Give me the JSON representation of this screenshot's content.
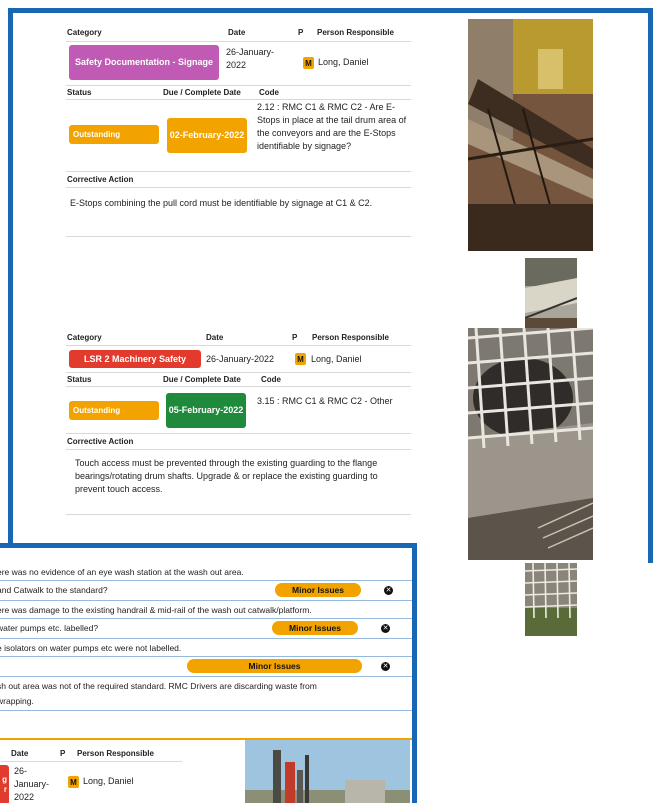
{
  "colors": {
    "frame_blue": "#1767b3",
    "status_orange": "#f2a300",
    "due_green": "#1f8a3b",
    "category_purple": "#c05ab5",
    "category_red": "#e23b2e"
  },
  "card1": {
    "hdr_category": "Category",
    "hdr_date": "Date",
    "hdr_p": "P",
    "hdr_person": "Person Responsible",
    "category": "Safety Documentation - Signage",
    "date": "26-January-2022",
    "priority": "M",
    "person": "Long, Daniel",
    "hdr_status": "Status",
    "hdr_due": "Due / Complete Date",
    "hdr_code": "Code",
    "status": "Outstanding",
    "due": "02-February-2022",
    "code": "2.12 : RMC C1 & RMC C2 - Are E-Stops in place at the tail drum area of the conveyors and are the E-Stops identifiable by signage?",
    "hdr_action": "Corrective Action",
    "action": "E-Stops combining the pull cord must be identifiable by signage at C1 & C2."
  },
  "card2": {
    "hdr_category": "Category",
    "hdr_date": "Date",
    "hdr_p": "P",
    "hdr_person": "Person Responsible",
    "category": "LSR 2 Machinery Safety",
    "date": "26-January-2022",
    "priority": "M",
    "person": "Long, Daniel",
    "hdr_status": "Status",
    "hdr_due": "Due / Complete Date",
    "hdr_code": "Code",
    "status": "Outstanding",
    "due": "05-February-2022",
    "code": "3.15 : RMC C1 & RMC C2 - Other",
    "hdr_action": "Corrective Action",
    "action": "Touch access must be prevented through the existing guarding to the flange bearings/rotating drum shafts. Upgrade & or replace the existing guarding to prevent touch access."
  },
  "overlay": {
    "line1": "ere was no evidence of an eye wash station at the wash out area.",
    "line2": "and Catwalk to the standard?",
    "pill1": "Minor Issues",
    "line3": "ere was damage to the existing handrail & mid-rail of the wash out catwalk/platform.",
    "line4": "water pumps etc. labelled?",
    "pill2": "Minor Issues",
    "line5": "e isolators on water pumps etc were not labelled.",
    "pill3": "Minor Issues",
    "line6": "sh out area was not of the required standard. RMC Drivers are discarding waste from",
    "line7": "wrapping.",
    "hdr_date": "Date",
    "hdr_p": "P",
    "hdr_person": "Person Responsible",
    "chip_fragment_top": "g",
    "chip_fragment_bottom": "r",
    "date": "26-January-2022",
    "priority": "M",
    "person": "Long, Daniel"
  }
}
